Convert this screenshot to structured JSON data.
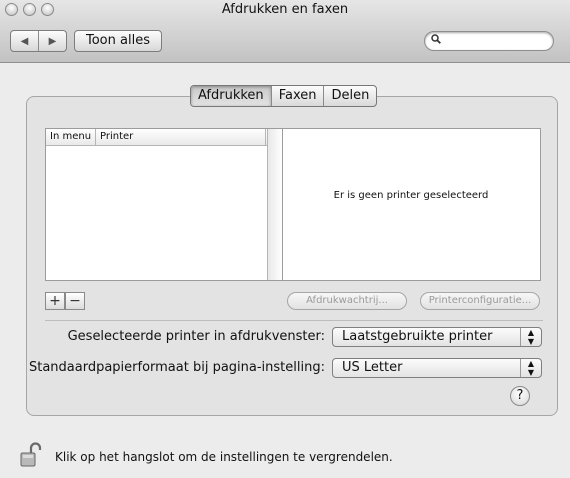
{
  "window": {
    "title": "Afdrukken en faxen"
  },
  "toolbar": {
    "show_all_label": "Toon alles",
    "back_icon": "◀",
    "forward_icon": "▶",
    "search_placeholder": ""
  },
  "tabs": [
    {
      "label": "Afdrukken",
      "active": true
    },
    {
      "label": "Faxen",
      "active": false
    },
    {
      "label": "Delen",
      "active": false
    }
  ],
  "printer_list": {
    "columns": [
      "In menu",
      "Printer"
    ],
    "rows": []
  },
  "detail": {
    "message": "Er is geen printer geselecteerd"
  },
  "list_controls": {
    "add": "+",
    "remove": "−"
  },
  "buttons": {
    "queue": "Afdrukwachtrij...",
    "config": "Printerconfiguratie..."
  },
  "settings": {
    "selected_printer_label": "Geselecteerde printer in afdrukvenster:",
    "selected_printer_value": "Laatstgebruikte printer",
    "paper_size_label": "Standaardpapierformaat bij pagina-instelling:",
    "paper_size_value": "US Letter"
  },
  "help": {
    "label": "?"
  },
  "lock": {
    "message": "Klik op het hangslot om de instellingen te vergrendelen."
  }
}
